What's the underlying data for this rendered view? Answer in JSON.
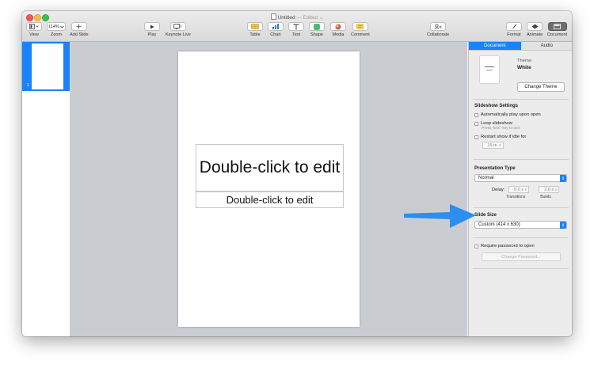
{
  "window": {
    "title": "Untitled",
    "edited": " — Edited ⌄"
  },
  "toolbar": {
    "view_label": "View",
    "zoom_label": "Zoom",
    "zoom_value": "114%",
    "add_slide_label": "Add Slide",
    "play_label": "Play",
    "keynote_live_label": "Keynote Live",
    "table_label": "Table",
    "chart_label": "Chart",
    "text_label": "Text",
    "shape_label": "Shape",
    "media_label": "Media",
    "comment_label": "Comment",
    "collaborate_label": "Collaborate",
    "format_label": "Format",
    "animate_label": "Animate",
    "document_label": "Document"
  },
  "sidebar": {
    "slide_number": "1"
  },
  "slide": {
    "title_placeholder": "Double-click to edit",
    "body_placeholder": "Double-click to edit"
  },
  "inspector": {
    "tabs": [
      {
        "label": "Document"
      },
      {
        "label": "Audio"
      }
    ],
    "theme_caption": "Theme",
    "theme_name": "White",
    "change_theme_label": "Change Theme",
    "slideshow_settings": {
      "title": "Slideshow Settings",
      "autoplay_label": "Automatically play upon open",
      "loop_label": "Loop slideshow",
      "loop_hint": "Press \"Esc\" key to exit",
      "restart_label": "Restart show if idle for",
      "idle_value": "15 m"
    },
    "presentation_type": {
      "title": "Presentation Type",
      "value": "Normal",
      "delay_label": "Delay:",
      "transitions_value": "5.0 s",
      "builds_value": "2.0 s",
      "transitions_label": "Transitions",
      "builds_label": "Builds"
    },
    "slide_size": {
      "title": "Slide Size",
      "value": "Custom (414 x 630)"
    },
    "password": {
      "require_label": "Require password to open",
      "change_label": "Change Password..."
    }
  },
  "colors": {
    "accent": "#1a82fb",
    "annotation_arrow": "#2b8ef0"
  }
}
